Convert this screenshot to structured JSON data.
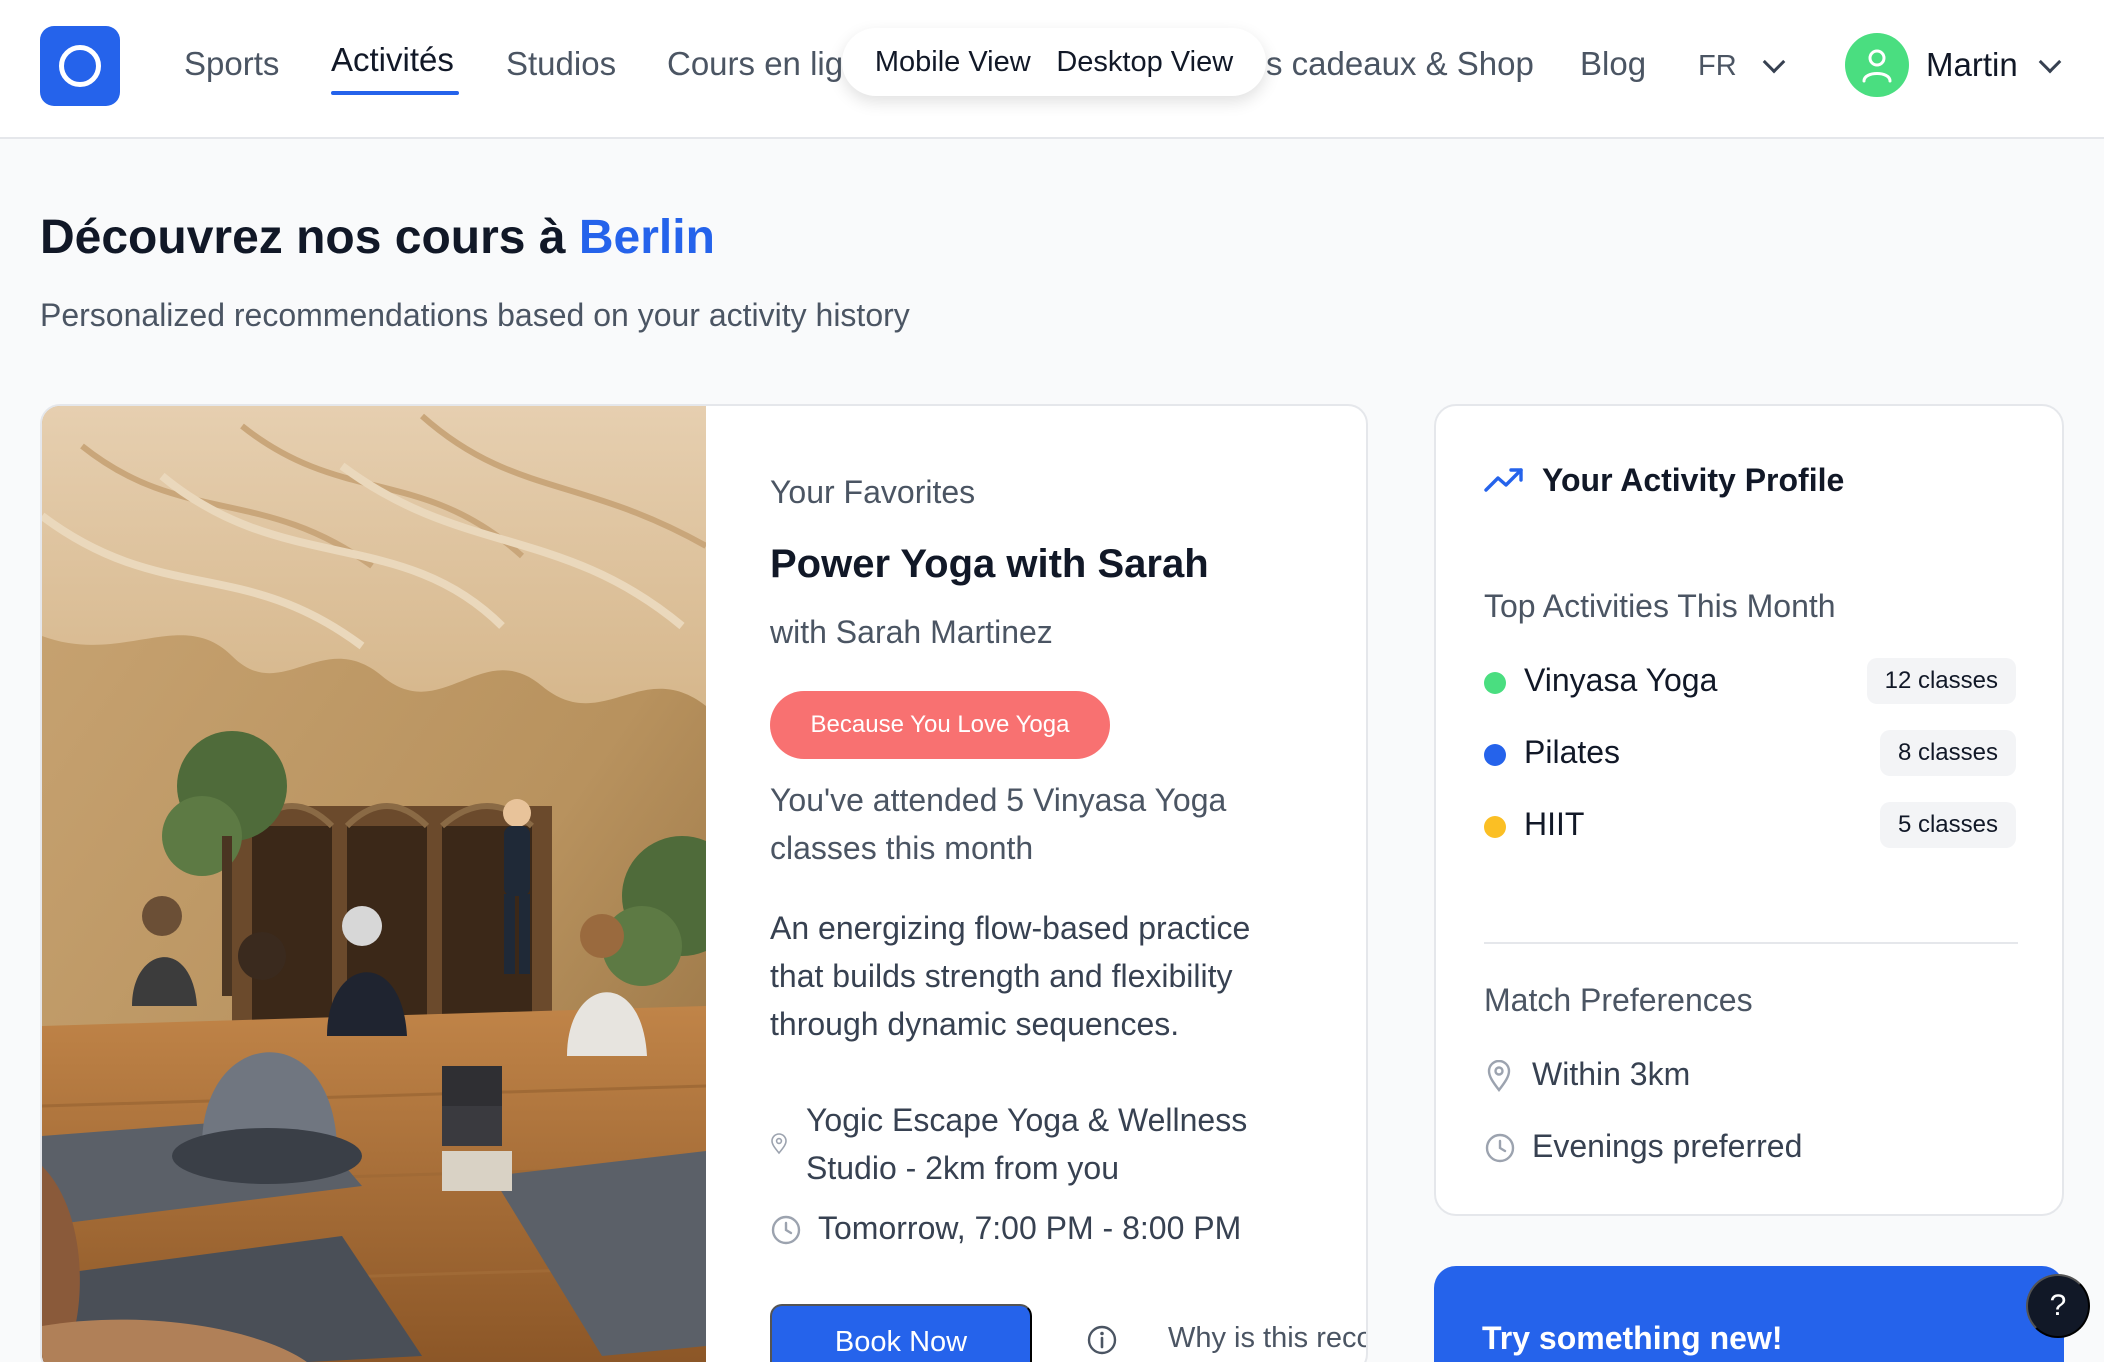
{
  "colors": {
    "accent": "#2563eb",
    "badge": "#f87171",
    "avatar": "#4ade80",
    "dot_vinyasa": "#4ade80",
    "dot_pilates": "#2563eb",
    "dot_hiit": "#fbbf24"
  },
  "header": {
    "nav": [
      {
        "label": "Sports"
      },
      {
        "label": "Activités",
        "active": true
      },
      {
        "label": "Studios"
      },
      {
        "label": "Cours en lig"
      },
      {
        "label": "s cadeaux & Shop"
      },
      {
        "label": "Blog"
      }
    ],
    "view_toggle": {
      "mobile": "Mobile View",
      "desktop": "Desktop View"
    },
    "language": "FR",
    "user": {
      "name": "Martin",
      "icon": "user-icon"
    }
  },
  "heading": {
    "title_prefix": "Découvrez nos cours à ",
    "city": "Berlin",
    "subtitle": "Personalized recommendations based on your activity history"
  },
  "recommendation": {
    "category": "Your Favorites",
    "title": "Power Yoga with Sarah",
    "instructor": "with Sarah Martinez",
    "reason_badge": "Because You Love Yoga",
    "reason_text": "You've attended 5 Vinyasa Yoga classes this month",
    "description": "An energizing flow-based practice that builds strength and flexibility through dynamic sequences.",
    "location": "Yogic Escape Yoga & Wellness Studio - 2km from you",
    "time": "Tomorrow, 7:00 PM - 8:00 PM",
    "book_label": "Book Now",
    "why_label": "Why is this recom"
  },
  "profile": {
    "title": "Your Activity Profile",
    "top_label": "Top Activities This Month",
    "activities": [
      {
        "name": "Vinyasa Yoga",
        "count": "12 classes"
      },
      {
        "name": "Pilates",
        "count": "8 classes"
      },
      {
        "name": "HIIT",
        "count": "5 classes"
      }
    ],
    "prefs_label": "Match Preferences",
    "prefs": [
      {
        "text": "Within 3km",
        "icon": "pin-icon"
      },
      {
        "text": "Evenings preferred",
        "icon": "clock-icon"
      }
    ]
  },
  "try_new": {
    "title": "Try something new!"
  },
  "help": {
    "label": "?"
  }
}
